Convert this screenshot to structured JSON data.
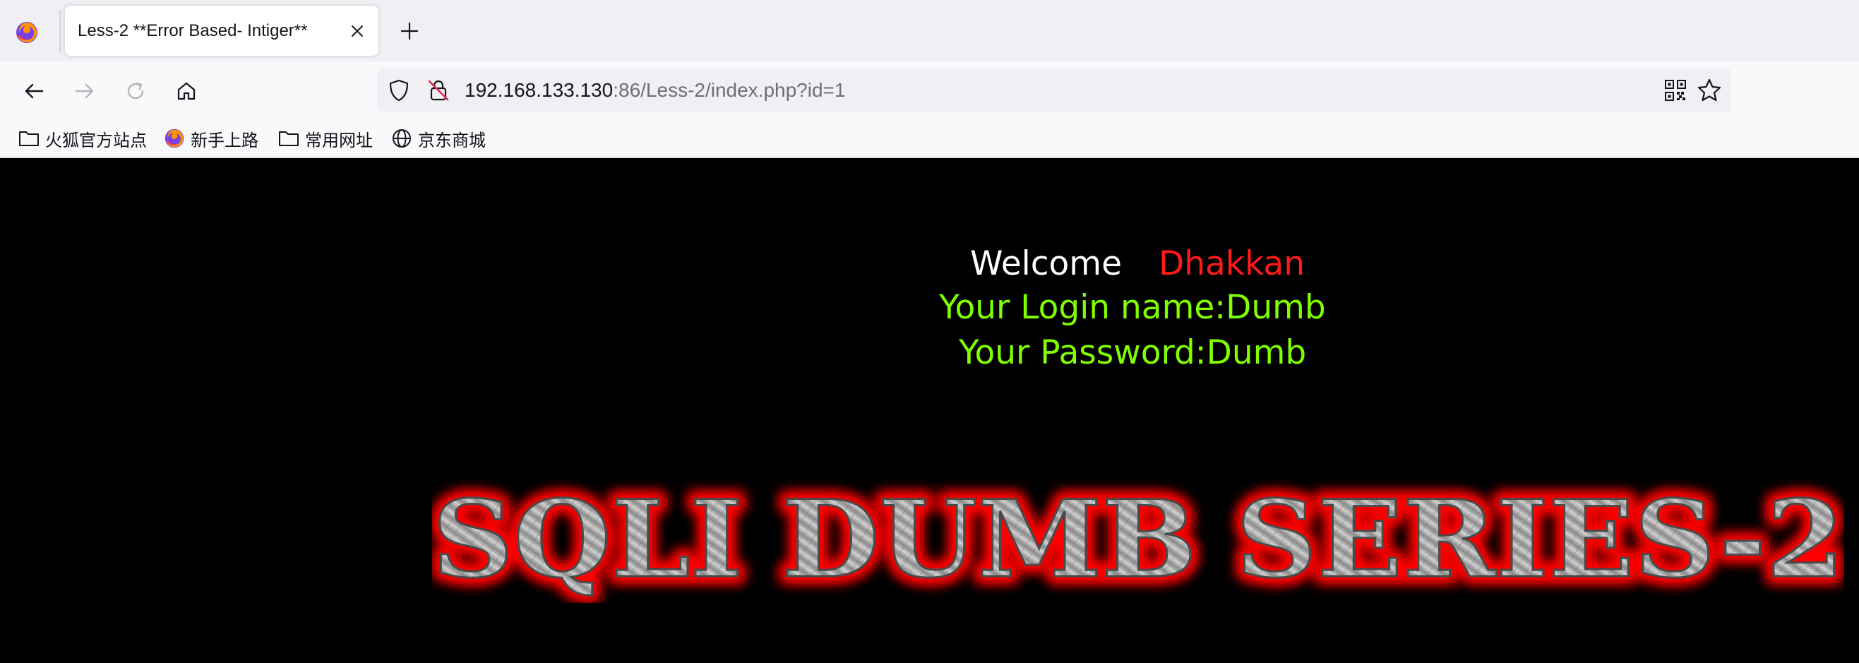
{
  "browser": {
    "tab": {
      "title": "Less-2 **Error Based- Intiger**"
    },
    "url": {
      "host": "192.168.133.130",
      "rest": ":86/Less-2/index.php?id=1"
    },
    "bookmarks": [
      {
        "label": "火狐官方站点",
        "icon": "folder-icon"
      },
      {
        "label": "新手上路",
        "icon": "firefox-icon"
      },
      {
        "label": "常用网址",
        "icon": "folder-icon"
      },
      {
        "label": "京东商城",
        "icon": "globe-icon"
      }
    ]
  },
  "page": {
    "welcome": "Welcome",
    "welcome_name": "Dhakkan",
    "login_line": "Your Login name:Dumb",
    "password_line": "Your Password:Dumb",
    "banner_text": "SQLI DUMB SERIES-2",
    "colors": {
      "welcome": "#ffffff",
      "name": "#ff1a1a",
      "result": "#7fff00",
      "banner_glow": "#ff0000"
    }
  }
}
